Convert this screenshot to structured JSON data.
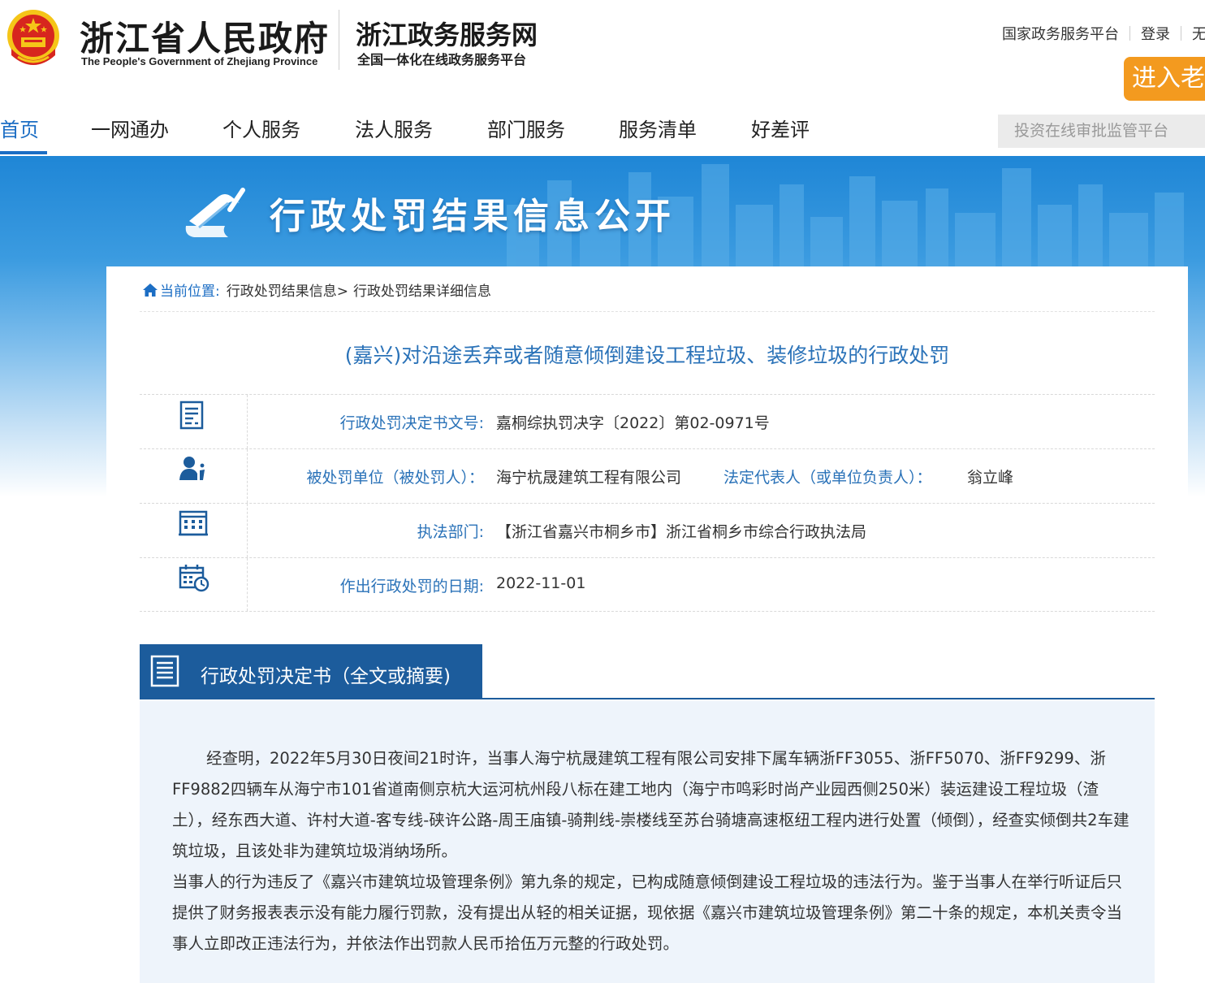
{
  "header": {
    "gov_title": "浙江省人民政府",
    "gov_subtitle": "The People's Government of Zhejiang Province",
    "site_title": "浙江政务服务网",
    "site_subtitle": "全国一体化在线政务服务平台",
    "top_links": [
      "国家政务服务平台",
      "登录",
      "无"
    ],
    "elder_button": "进入老"
  },
  "nav": {
    "items": [
      "首页",
      "一网通办",
      "个人服务",
      "法人服务",
      "部门服务",
      "服务清单",
      "好差评"
    ],
    "active_index": 0,
    "search_placeholder": "投资在线审批监管平台"
  },
  "banner": {
    "title": "行政处罚结果信息公开"
  },
  "breadcrumb": {
    "label": "当前位置:",
    "items": [
      "行政处罚结果信息>",
      "行政处罚结果详细信息"
    ]
  },
  "page_title": "(嘉兴)对沿途丢弃或者随意倾倒建设工程垃圾、装修垃圾的行政处罚",
  "info": {
    "doc_number_label": "行政处罚决定书文号:",
    "doc_number_value": "嘉桐综执罚决字〔2022〕第02-0971号",
    "party_label": "被处罚单位（被处罚人）：",
    "party_value": "海宁杭晟建筑工程有限公司",
    "legal_rep_label": "法定代表人（或单位负责人）：",
    "legal_rep_value": "翁立峰",
    "dept_label": "执法部门:",
    "dept_value": "【浙江省嘉兴市桐乡市】浙江省桐乡市综合行政执法局",
    "date_label": "作出行政处罚的日期:",
    "date_value": "2022-11-01"
  },
  "section": {
    "title": "行政处罚决定书（全文或摘要)"
  },
  "body": {
    "paragraph1": "经查明，2022年5月30日夜间21时许，当事人海宁杭晟建筑工程有限公司安排下属车辆浙FF3055、浙FF5070、浙FF9299、浙FF9882四辆车从海宁市101省道南侧京杭大运河杭州段八标在建工地内（海宁市鸣彩时尚产业园西侧250米）装运建设工程垃圾（渣土），经东西大道、许村大道-客专线-硖许公路-周王庙镇-骑荆线-崇楼线至苏台骑塘高速枢纽工程内进行处置（倾倒），经查实倾倒共2车建筑垃圾，且该处非为建筑垃圾消纳场所。",
    "paragraph2": "当事人的行为违反了《嘉兴市建筑垃圾管理条例》第九条的规定，已构成随意倾倒建设工程垃圾的违法行为。鉴于当事人在举行听证后只提供了财务报表表示没有能力履行罚款，没有提出从轻的相关证据，现依据《嘉兴市建筑垃圾管理条例》第二十条的规定，本机关责令当事人立即改正违法行为，并依法作出罚款人民币拾伍万元整的行政处罚。"
  },
  "colors": {
    "primary_blue": "#1c6ec4",
    "label_blue": "#2a72b8",
    "section_blue": "#1c5c9c",
    "elder_orange": "#f39a1f",
    "emblem_red": "#d7261e",
    "emblem_gold": "#f5c518"
  }
}
